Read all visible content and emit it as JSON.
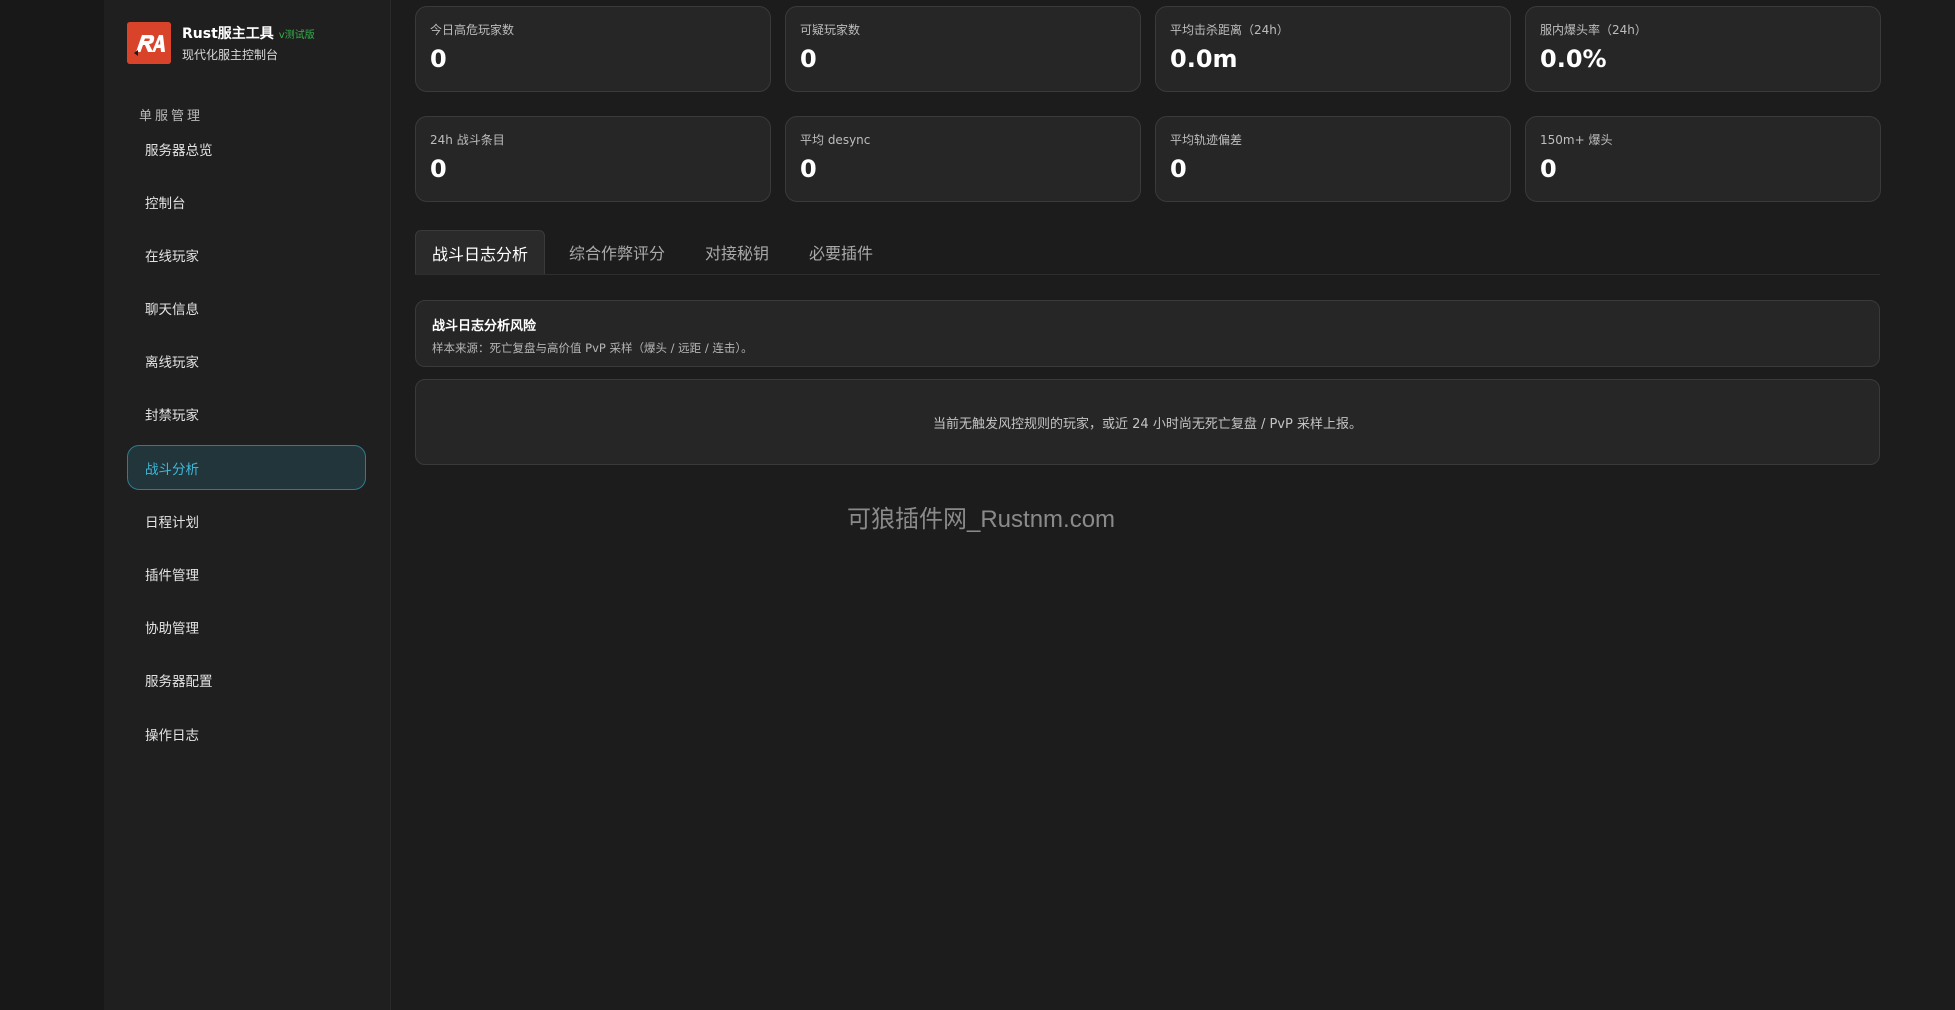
{
  "brand": {
    "title": "Rust服主工具",
    "badge": "v测试版",
    "subtitle": "现代化服主控制台",
    "logo_icon": "ra-logo-icon"
  },
  "sidebar": {
    "section_label": "单服管理",
    "items": [
      {
        "label": "服务器总览",
        "active": false
      },
      {
        "label": "控制台",
        "active": false
      },
      {
        "label": "在线玩家",
        "active": false
      },
      {
        "label": "聊天信息",
        "active": false
      },
      {
        "label": "离线玩家",
        "active": false
      },
      {
        "label": "封禁玩家",
        "active": false
      },
      {
        "label": "战斗分析",
        "active": true
      },
      {
        "label": "日程计划",
        "active": false
      },
      {
        "label": "插件管理",
        "active": false
      },
      {
        "label": "协助管理",
        "active": false
      },
      {
        "label": "服务器配置",
        "active": false
      },
      {
        "label": "操作日志",
        "active": false
      }
    ]
  },
  "stats": {
    "row1": [
      {
        "label": "今日高危玩家数",
        "value": "0"
      },
      {
        "label": "可疑玩家数",
        "value": "0"
      },
      {
        "label": "平均击杀距离（24h）",
        "value": "0.0m"
      },
      {
        "label": "服内爆头率（24h）",
        "value": "0.0%"
      }
    ],
    "row2": [
      {
        "label": "24h 战斗条目",
        "value": "0"
      },
      {
        "label": "平均 desync",
        "value": "0"
      },
      {
        "label": "平均轨迹偏差",
        "value": "0"
      },
      {
        "label": "150m+ 爆头",
        "value": "0"
      }
    ]
  },
  "tabs": [
    {
      "label": "战斗日志分析",
      "active": true
    },
    {
      "label": "综合作弊评分",
      "active": false
    },
    {
      "label": "对接秘钥",
      "active": false
    },
    {
      "label": "必要插件",
      "active": false
    }
  ],
  "panel": {
    "title": "战斗日志分析风险",
    "subtitle": "样本来源：死亡复盘与高价值 PvP 采样（爆头 / 远距 / 连击）。",
    "empty_message": "当前无触发风控规则的玩家，或近 24 小时尚无死亡复盘 / PvP 采样上报。"
  },
  "watermark": "可狼插件网_Rustnm.com",
  "colors": {
    "accent": "#3fb8d8",
    "active_bg": "#22353b",
    "badge": "#35b14b",
    "logo": "#d8432a"
  }
}
